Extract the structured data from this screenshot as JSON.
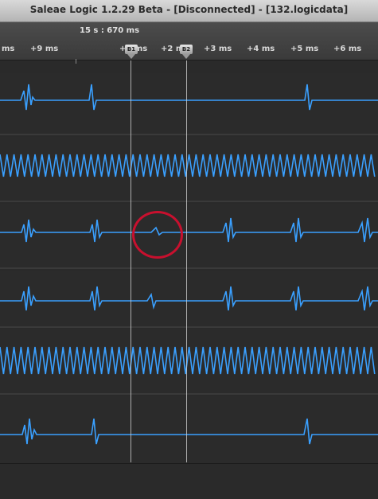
{
  "window": {
    "title": "Saleae Logic 1.2.29 Beta - [Disconnected] - [132.logicdata]"
  },
  "timeline": {
    "absolute_time": "15 s : 670 ms",
    "ticks": [
      {
        "label": "ms"
      },
      {
        "label": "+9 ms"
      },
      {
        "label": "+1 ms"
      },
      {
        "label": "+2 ms"
      },
      {
        "label": "+3 ms"
      },
      {
        "label": "+4 ms"
      },
      {
        "label": "+5 ms"
      },
      {
        "label": "+6 ms"
      }
    ],
    "markers": [
      {
        "label": "B1"
      },
      {
        "label": "B2"
      }
    ]
  },
  "channels": [
    {
      "id": 1,
      "signal": "burst"
    },
    {
      "id": 2,
      "signal": "oscillation"
    },
    {
      "id": 3,
      "signal": "burst"
    },
    {
      "id": 4,
      "signal": "burst"
    },
    {
      "id": 5,
      "signal": "oscillation"
    },
    {
      "id": 6,
      "signal": "burst"
    }
  ],
  "colors": {
    "trace": "#3aa0ff",
    "highlight": "#c8102e",
    "background": "#2b2b2b"
  }
}
